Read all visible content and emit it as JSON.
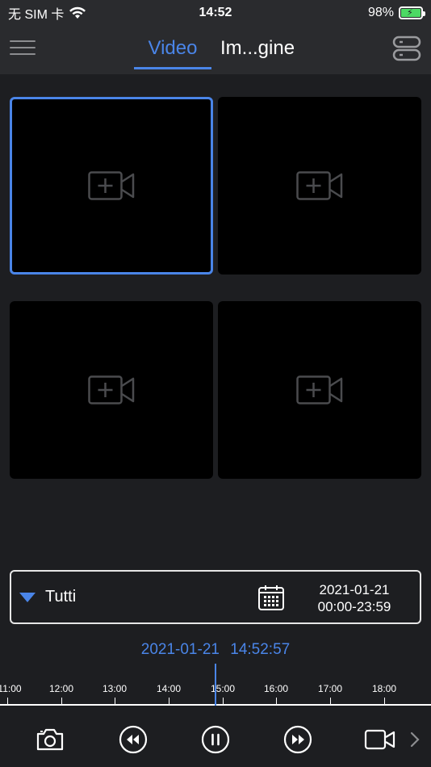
{
  "status_bar": {
    "carrier": "无 SIM 卡",
    "time": "14:52",
    "battery_percent": "98%",
    "battery_level": 0.98
  },
  "nav": {
    "tabs": [
      {
        "label": "Video",
        "active": true
      },
      {
        "label": "Im...gine",
        "active": false
      }
    ]
  },
  "video_grid": {
    "cells": [
      {
        "state": "empty",
        "selected": true
      },
      {
        "state": "empty",
        "selected": false
      },
      {
        "state": "empty",
        "selected": false
      },
      {
        "state": "empty",
        "selected": false
      }
    ],
    "empty_icon": "add-camera-icon"
  },
  "filter": {
    "dropdown_label": "Tutti",
    "date": "2021-01-21",
    "time_range": "00:00-23:59"
  },
  "timeline": {
    "current_date": "2021-01-21",
    "current_time": "14:52:57",
    "ticks": [
      "11:00",
      "12:00",
      "13:00",
      "14:00",
      "15:00",
      "16:00",
      "17:00",
      "18:00"
    ]
  },
  "toolbar": {
    "icons": [
      "camera-icon",
      "rewind-icon",
      "pause-icon",
      "fast-forward-icon",
      "video-record-icon",
      "chevron-right-icon"
    ]
  },
  "colors": {
    "accent": "#4a85e8",
    "background": "#1d1e21",
    "bar": "#2a2b2e",
    "cell": "#000000"
  }
}
